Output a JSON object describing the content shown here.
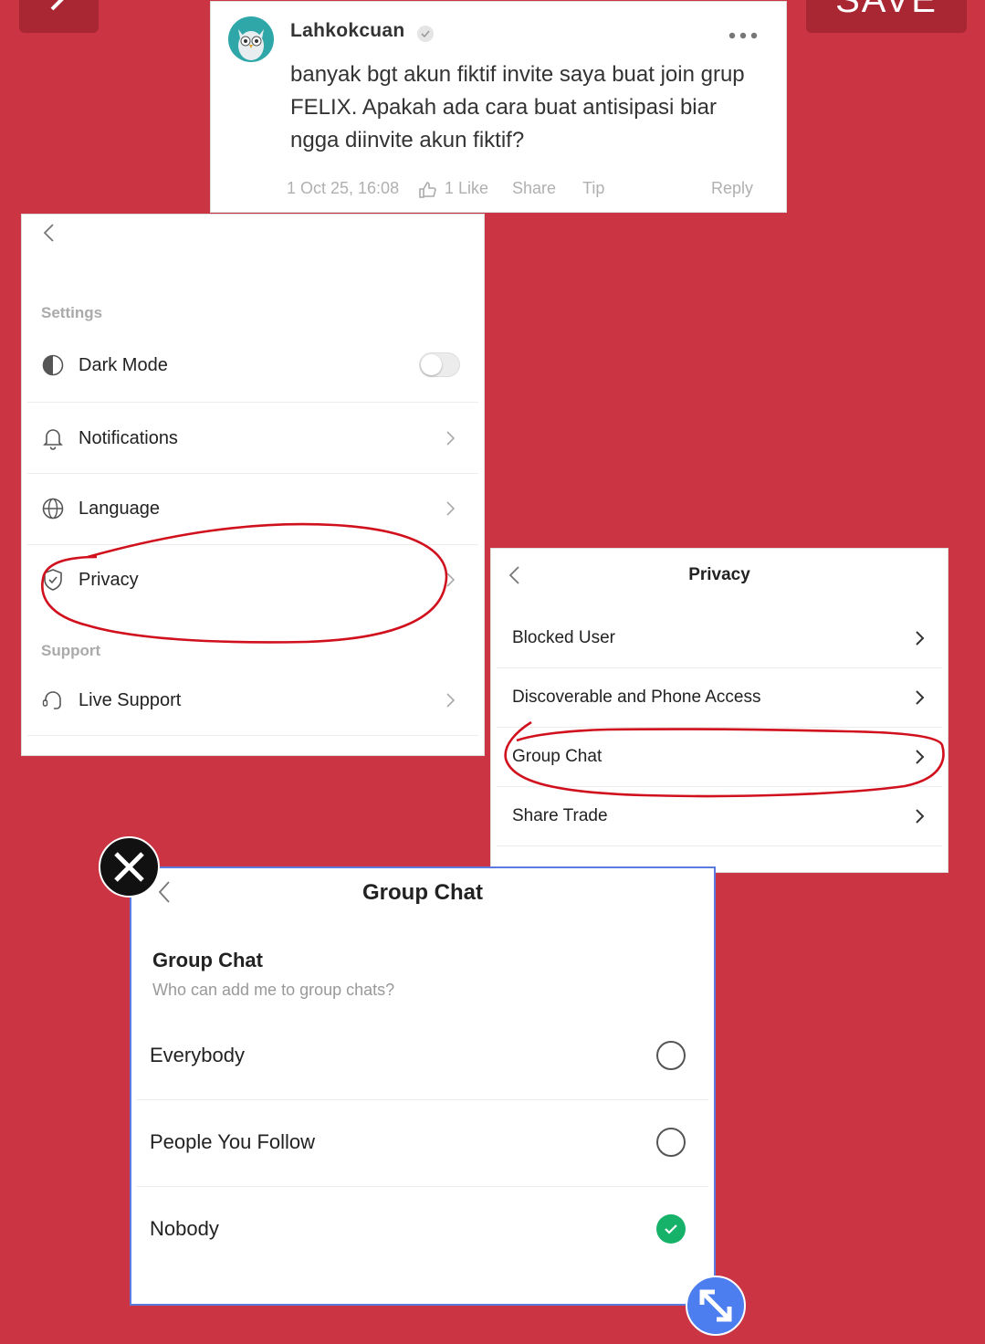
{
  "editor": {
    "save_label": "SAVE"
  },
  "comment": {
    "username": "Lahkokcuan",
    "text": "banyak bgt akun fiktif invite saya buat join grup FELIX. Apakah ada cara buat antisipasi biar ngga diinvite akun fiktif?",
    "timestamp": "1 Oct 25, 16:08",
    "likes": "1 Like",
    "share": "Share",
    "tip": "Tip",
    "reply": "Reply",
    "more_icon": "more-horizontal-icon",
    "verified_icon": "verified-badge-icon"
  },
  "settings": {
    "section_settings": "Settings",
    "section_support": "Support",
    "dark_mode": {
      "label": "Dark Mode",
      "enabled": false
    },
    "items": [
      {
        "label": "Notifications",
        "icon": "bell-icon"
      },
      {
        "label": "Language",
        "icon": "globe-icon"
      },
      {
        "label": "Privacy",
        "icon": "shield-icon"
      }
    ],
    "support_items": [
      {
        "label": "Live Support",
        "icon": "headset-icon"
      }
    ]
  },
  "privacy": {
    "title": "Privacy",
    "items": [
      {
        "label": "Blocked User"
      },
      {
        "label": "Discoverable and Phone Access"
      },
      {
        "label": "Group Chat"
      },
      {
        "label": "Share Trade"
      }
    ]
  },
  "group_chat": {
    "header_title": "Group Chat",
    "section_title": "Group Chat",
    "question": "Who can add me to group chats?",
    "options": [
      {
        "label": "Everybody",
        "selected": false
      },
      {
        "label": "People You Follow",
        "selected": false
      },
      {
        "label": "Nobody",
        "selected": true
      }
    ]
  },
  "colors": {
    "background": "#cb3442",
    "highlight_stroke": "#d0101d",
    "selected_green": "#17b26a",
    "resize_blue": "#4c7ef0"
  }
}
